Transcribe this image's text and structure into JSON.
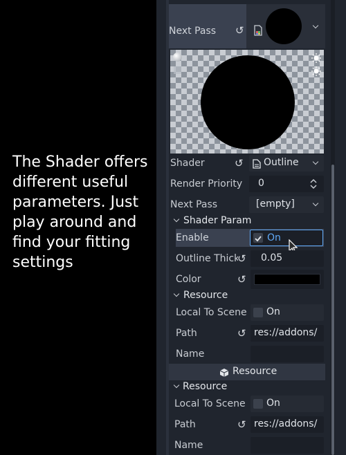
{
  "caption": "The Shader offers different useful parameters. Just play around and find your fitting settings",
  "colors": {
    "accent": "#5fa8f5",
    "inspector_background": "#20252e",
    "field_background": "#1b1f27",
    "selected_row": "#3a4150"
  },
  "inspector": {
    "next_pass_top": {
      "label": "Next Pass"
    },
    "preview": {
      "sphere_icon": "sphere-icon",
      "cube_icon": "cube-icon",
      "light1_icon": "light1-icon",
      "light2_icon": "light2-icon"
    },
    "shader": {
      "label": "Shader",
      "value": "Outline"
    },
    "render_priority": {
      "label": "Render Priority",
      "value": "0"
    },
    "next_pass": {
      "label": "Next Pass",
      "value": "[empty]"
    },
    "shader_param": {
      "header": "Shader Param",
      "enable": {
        "label": "Enable",
        "value": "On",
        "checked": true
      },
      "outline_thickness": {
        "label": "Outline Thick",
        "value": "0.05"
      },
      "color": {
        "label": "Color",
        "swatch": "#000000"
      }
    },
    "resource_inner": {
      "header": "Resource",
      "local_to_scene": {
        "label": "Local To Scene",
        "value": "On"
      },
      "path": {
        "label": "Path",
        "value": "res://addons/"
      },
      "name": {
        "label": "Name",
        "value": ""
      }
    },
    "resource_button": {
      "label": "Resource"
    },
    "resource_outer": {
      "header": "Resource",
      "local_to_scene": {
        "label": "Local To Scene",
        "value": "On"
      },
      "path": {
        "label": "Path",
        "value": "res://addons/"
      },
      "name": {
        "label": "Name",
        "value": ""
      }
    }
  }
}
